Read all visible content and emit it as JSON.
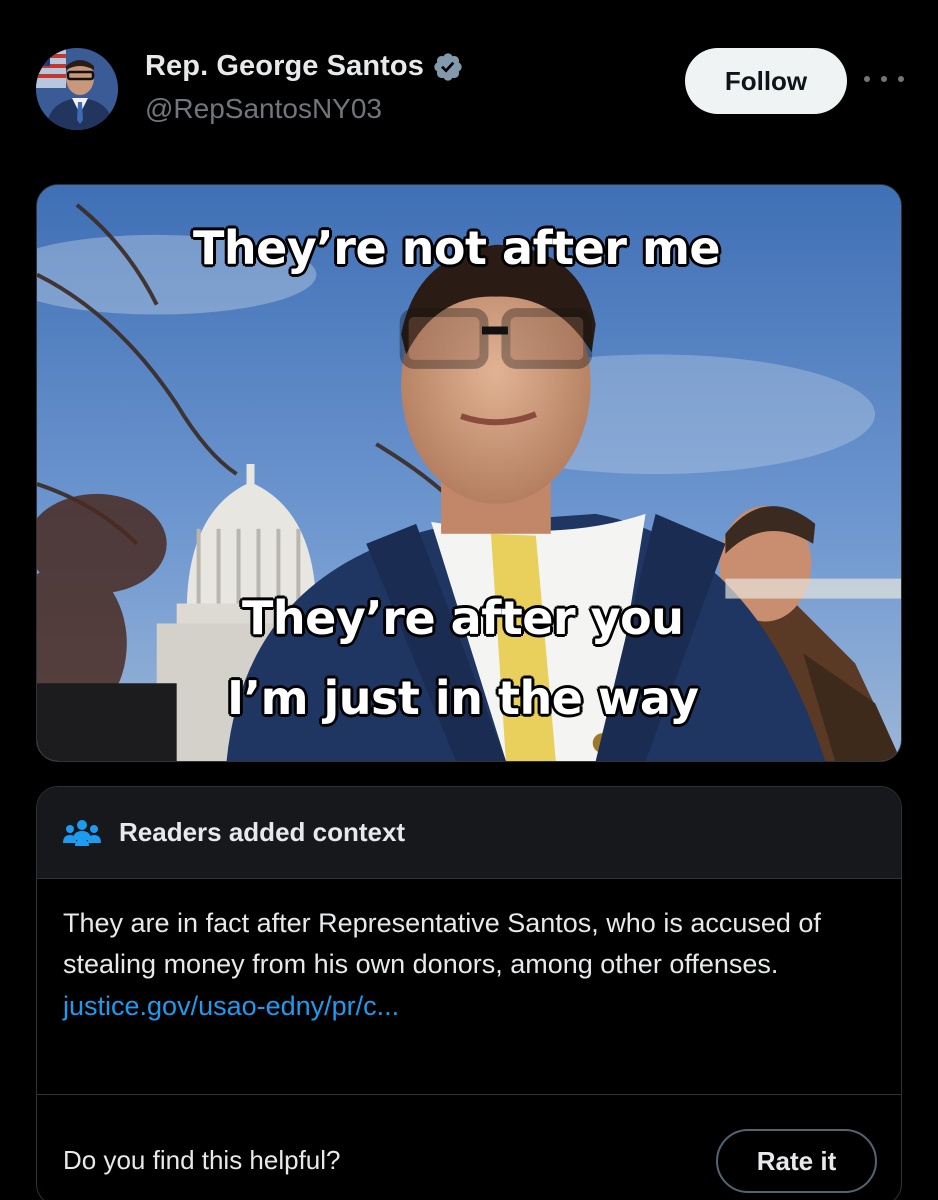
{
  "author": {
    "display_name": "Rep. George Santos",
    "handle": "@RepSantosNY03",
    "verified": true,
    "avatar_icon": "avatar-photo"
  },
  "header": {
    "follow_label": "Follow",
    "more_icon": "more-horizontal-icon"
  },
  "media": {
    "caption_top": "They’re not after me",
    "caption_mid": "They’re after you",
    "caption_bot": "I’m just in the way"
  },
  "community_note": {
    "title": "Readers added context",
    "icon": "people-icon",
    "body": "They are in fact after Representative Santos, who is accused of stealing money from his own donors, among other offenses.",
    "link_text": "justice.gov/usao-edny/pr/c...",
    "helpful_prompt": "Do you find this helpful?",
    "rate_label": "Rate it"
  },
  "colors": {
    "background": "#000000",
    "primary_text": "#e7e9ea",
    "secondary_text": "#71767b",
    "link": "#1d9bf0",
    "note_icon": "#1d9bf0",
    "border": "#2f3336"
  }
}
